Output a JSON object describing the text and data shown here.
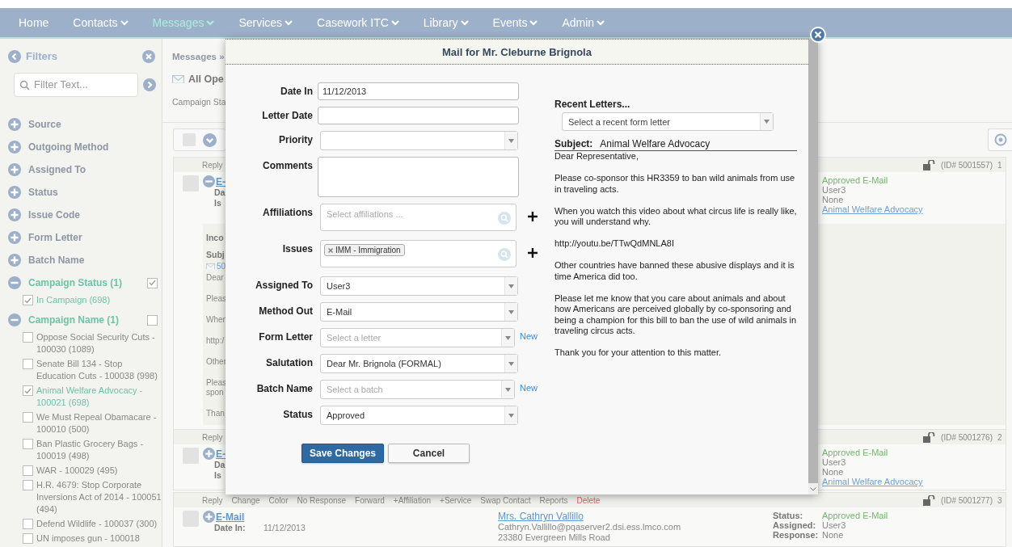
{
  "nav": [
    {
      "label": "Home",
      "dropdown": false,
      "selected": false
    },
    {
      "label": "Contacts",
      "dropdown": true,
      "selected": false
    },
    {
      "label": "Messages",
      "dropdown": true,
      "selected": true
    },
    {
      "label": "Services",
      "dropdown": true,
      "selected": false
    },
    {
      "label": "Casework ITC",
      "dropdown": true,
      "selected": false
    },
    {
      "label": "Library",
      "dropdown": true,
      "selected": false
    },
    {
      "label": "Events",
      "dropdown": true,
      "selected": false
    },
    {
      "label": "Admin",
      "dropdown": true,
      "selected": false
    }
  ],
  "sidebar": {
    "title": "Filters",
    "search": {
      "placeholder": "Filter Text..."
    },
    "groups": [
      {
        "label": "Source",
        "expanded": false
      },
      {
        "label": "Outgoing Method",
        "expanded": false
      },
      {
        "label": "Assigned To",
        "expanded": false
      },
      {
        "label": "Status",
        "expanded": false
      },
      {
        "label": "Issue Code",
        "expanded": false
      },
      {
        "label": "Form Letter",
        "expanded": false
      },
      {
        "label": "Batch Name",
        "expanded": false
      },
      {
        "label": "Campaign Status (1)",
        "expanded": true,
        "checked": true,
        "items": [
          {
            "label": "In Campaign (698)",
            "checked": true
          }
        ]
      },
      {
        "label": "Campaign Name (1)",
        "expanded": true,
        "checked": false,
        "items": [
          {
            "label": "Oppose Social Security Cuts - 100030 (1089)",
            "checked": false
          },
          {
            "label": "Senate Bill 134 - Stop Education Cuts - 100038 (998)",
            "checked": false
          },
          {
            "label": "Animal Welfare Advocacy - 100021 (698)",
            "checked": true
          },
          {
            "label": "We Must Repeal Obamacare - 100010 (500)",
            "checked": false
          },
          {
            "label": "Ban Plastic Grocery Bags - 100019 (498)",
            "checked": false
          },
          {
            "label": "WAR - 100029 (495)",
            "checked": false
          },
          {
            "label": "H.R. 4679: Stop Corporate Inversions Act of 2014 - 100051 (494)",
            "checked": false
          },
          {
            "label": "Defend Wildlife - 100037 (300)",
            "checked": false
          },
          {
            "label": "UN imposes gun - 100018",
            "checked": false
          }
        ]
      }
    ]
  },
  "messages": {
    "breadcrumb": "Messages »",
    "heading": "All Ope",
    "filter_summary": "Campaign Sta",
    "select_all": {
      "checked": false
    },
    "cards": [
      {
        "actions": [
          {
            "label": "Reply",
            "kind": "normal"
          }
        ],
        "id": "(ID# 5001557)",
        "number": "1",
        "checked": false,
        "expanded": true,
        "link": "E-",
        "details": [
          {
            "label": "Da"
          },
          {
            "label": "Is"
          }
        ],
        "status_fields": [
          {
            "value": "Approved E-Mail",
            "kind": "status"
          },
          {
            "value": "User3",
            "kind": "text"
          },
          {
            "value": "None",
            "kind": "text"
          },
          {
            "value": "Animal Welfare Advocacy",
            "kind": "link"
          }
        ],
        "letter": {
          "heading": "Inco",
          "subject_label": "Subj",
          "attachment": "50",
          "paragraphs": [
            "Dear",
            "Pleas",
            "When",
            "http:/",
            "Other",
            "Pleas\nspon",
            "Than"
          ]
        }
      },
      {
        "actions": [
          {
            "label": "Reply",
            "kind": "normal"
          }
        ],
        "id": "(ID# 5001276)",
        "number": "2",
        "checked": false,
        "expanded": false,
        "link": "E-",
        "details": [
          {
            "label": "Da"
          },
          {
            "label": "Is"
          }
        ],
        "status_fields": [
          {
            "value": "Approved E-Mail",
            "kind": "status"
          },
          {
            "value": "User3",
            "kind": "text"
          },
          {
            "value": "None",
            "kind": "text"
          },
          {
            "value": "Animal Welfare Advocacy",
            "kind": "link"
          }
        ]
      },
      {
        "actions": [
          {
            "label": "Reply",
            "kind": "normal"
          },
          {
            "label": "Change",
            "kind": "normal"
          },
          {
            "label": "Color",
            "kind": "normal"
          },
          {
            "label": "No Response",
            "kind": "normal"
          },
          {
            "label": "Forward",
            "kind": "normal"
          },
          {
            "label": "+Affiliation",
            "kind": "normal"
          },
          {
            "label": "+Service",
            "kind": "normal"
          },
          {
            "label": "Swap Contact",
            "kind": "normal"
          },
          {
            "label": "Reports",
            "kind": "normal"
          },
          {
            "label": "Delete",
            "kind": "danger"
          }
        ],
        "id": "(ID# 5001277)",
        "number": "3",
        "checked": false,
        "expanded": false,
        "link": "E-Mail",
        "details": [
          {
            "label": "Date In:",
            "value": "11/12/2013"
          }
        ],
        "contact": {
          "name": "Mrs. Cathryn Vallillo",
          "lines": [
            "Cathryn.Vallillo@pqaserver2.dsi.ess.lmco.com",
            "23380 Evergreen Mills Road"
          ]
        },
        "status_fields": [
          {
            "label": "Status:",
            "value": "Approved E-Mail",
            "kind": "status"
          },
          {
            "label": "Assigned:",
            "value": "User3",
            "kind": "text"
          },
          {
            "label": "Response:",
            "value": "None",
            "kind": "text"
          }
        ]
      }
    ]
  },
  "dialog": {
    "title": "Mail for Mr. Cleburne Brignola",
    "fields": [
      {
        "label": "Date In",
        "kind": "text",
        "value": "11/12/2013"
      },
      {
        "label": "Letter Date",
        "kind": "text"
      },
      {
        "label": "Priority",
        "kind": "select"
      },
      {
        "label": "Comments",
        "kind": "textarea"
      },
      {
        "label": "Affiliations",
        "kind": "multiselect",
        "placeholder": "Select affiliations ...",
        "add": true
      },
      {
        "label": "Issues",
        "kind": "multiselect",
        "tags": [
          "IMM - Immigration"
        ],
        "add": true
      },
      {
        "label": "Assigned To",
        "kind": "select",
        "value": "User3"
      },
      {
        "label": "Method Out",
        "kind": "select",
        "value": "E-Mail"
      },
      {
        "label": "Form Letter",
        "kind": "select",
        "placeholder": "Select a letter",
        "new_link": "New"
      },
      {
        "label": "Salutation",
        "kind": "select",
        "value": "Dear Mr. Brignola (FORMAL)"
      },
      {
        "label": "Batch Name",
        "kind": "select",
        "placeholder": "Select a batch",
        "new_link": "New"
      },
      {
        "label": "Status",
        "kind": "select",
        "value": "Approved"
      }
    ],
    "recent_letters": {
      "label": "Recent Letters...",
      "placeholder": "Select a recent form letter"
    },
    "subject": {
      "label": "Subject:",
      "value": "Animal Welfare Advocacy"
    },
    "letter": [
      "Dear Representative,",
      "Please co-sponsor this HR3359 to ban wild animals from use in traveling acts.",
      "When you watch this video about what circus life is really like, you will understand why.",
      "http://youtu.be/TTwQdMNLA8I",
      "Other countries have banned these abusive displays and it is time America did too.",
      "Please let me know that you care about animals and about how Americans are perceived globally by co-sponsoring and being a champion for this bill to ban the use of wild animals in traveling circus acts.",
      "Thank you for your attention to this matter."
    ],
    "buttons": [
      {
        "label": "Save Changes",
        "kind": "primary"
      },
      {
        "label": "Cancel",
        "kind": "secondary"
      }
    ]
  }
}
